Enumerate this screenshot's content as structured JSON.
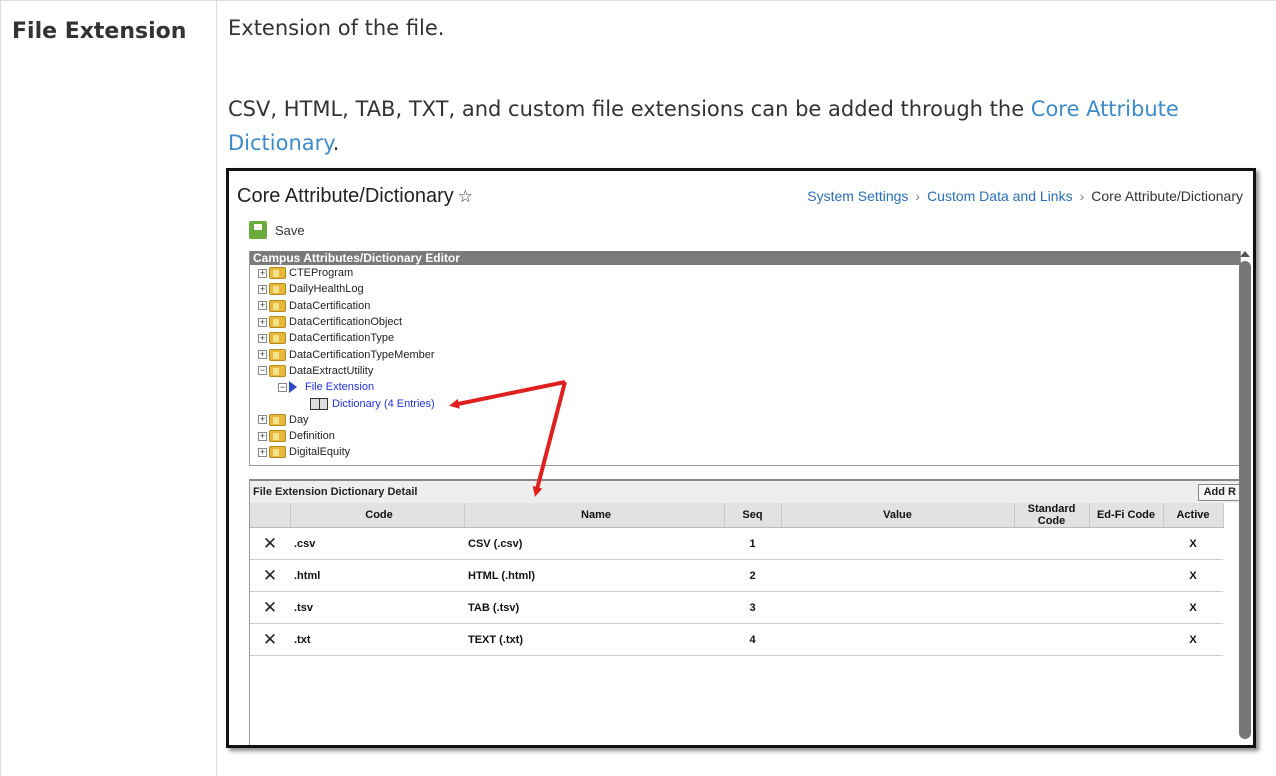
{
  "doc": {
    "term": "File Extension",
    "description_line1": "Extension of the file.",
    "description_line2_prefix": "CSV, HTML, TAB, TXT, and custom file extensions can be added through the ",
    "description_link": "Core Attribute Dictionary",
    "description_line2_suffix": "."
  },
  "screenshot": {
    "title": "Core Attribute/Dictionary",
    "breadcrumb": [
      "System Settings",
      "Custom Data and Links",
      "Core Attribute/Dictionary"
    ],
    "save_label": "Save",
    "tree_header": "Campus Attributes/Dictionary Editor",
    "tree_items": [
      "CTEProgram",
      "DailyHealthLog",
      "DataCertification",
      "DataCertificationObject",
      "DataCertificationType",
      "DataCertificationTypeMember",
      "DataExtractUtility"
    ],
    "tree_child": "File Extension",
    "tree_grandchild": "Dictionary (4 Entries)",
    "tree_items_after": [
      "Day",
      "Definition",
      "DigitalEquity"
    ],
    "detail_header": "File Extension Dictionary Detail",
    "add_button": "Add R",
    "columns": [
      "Code",
      "Name",
      "Seq",
      "Value",
      "Standard Code",
      "Ed-Fi Code",
      "Active"
    ],
    "rows": [
      {
        "code": ".csv",
        "name": "CSV (.csv)",
        "seq": "1",
        "value": "",
        "standard": "",
        "edfi": "",
        "active": "X"
      },
      {
        "code": ".html",
        "name": "HTML (.html)",
        "seq": "2",
        "value": "",
        "standard": "",
        "edfi": "",
        "active": "X"
      },
      {
        "code": ".tsv",
        "name": "TAB (.tsv)",
        "seq": "3",
        "value": "",
        "standard": "",
        "edfi": "",
        "active": "X"
      },
      {
        "code": ".txt",
        "name": "TEXT (.txt)",
        "seq": "4",
        "value": "",
        "standard": "",
        "edfi": "",
        "active": "X"
      }
    ],
    "colors": {
      "arrow": "#e02020",
      "link": "#3d8bc9",
      "save_icon": "#6aac3c",
      "tree_child": "#2233dd"
    },
    "icons": {
      "delete": "close-x-icon",
      "favorite": "star-icon",
      "save": "save-icon",
      "folder": "folder-icon"
    }
  }
}
